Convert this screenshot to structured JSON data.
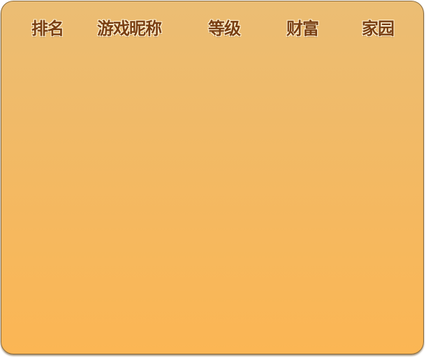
{
  "leaderboard": {
    "columns": {
      "rank": "排名",
      "nickname": "游戏昵称",
      "level": "等级",
      "wealth": "财富",
      "home": "家园"
    },
    "rows": []
  }
}
